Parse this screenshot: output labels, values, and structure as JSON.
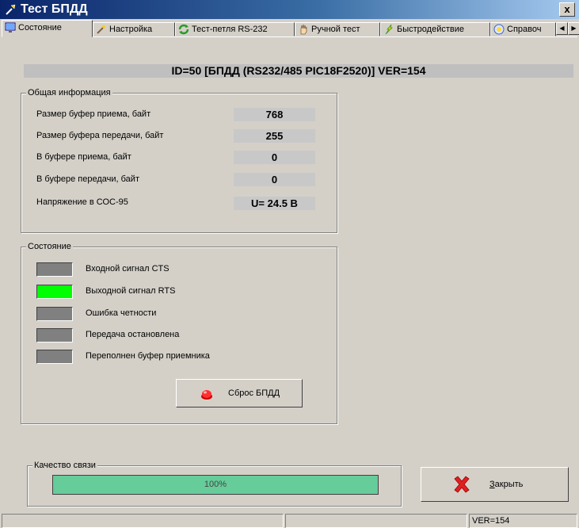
{
  "window": {
    "title": "Тест БПДД",
    "close_label": "x"
  },
  "tabs": [
    {
      "label": "Состояние",
      "icon": "monitor-icon"
    },
    {
      "label": "Настройка",
      "icon": "wand-icon"
    },
    {
      "label": "Тест-петля RS-232",
      "icon": "arrows-loop-icon"
    },
    {
      "label": "Ручной тест",
      "icon": "hand-icon"
    },
    {
      "label": "Быстродействие",
      "icon": "lightning-icon"
    },
    {
      "label": "Справоч",
      "icon": "info-icon"
    }
  ],
  "header": {
    "device_id": "ID=50 [БПДД (RS232/485 PIC18F2520)]  VER=154"
  },
  "general_info": {
    "title": "Общая информация",
    "rows": [
      {
        "label": "Размер буфер приема, байт",
        "value": "768"
      },
      {
        "label": "Размер буфера передачи, байт",
        "value": "255"
      },
      {
        "label": "В буфере приема, байт",
        "value": "0"
      },
      {
        "label": "В буфере передачи, байт",
        "value": "0"
      },
      {
        "label": "Напряжение в СОС-95",
        "value": "U= 24.5 В"
      }
    ]
  },
  "state": {
    "title": "Состояние",
    "signals": [
      {
        "label": "Входной сигнал CTS",
        "color": "#808080",
        "active": false
      },
      {
        "label": "Выходной сигнал RTS",
        "color": "#00ff00",
        "active": true
      },
      {
        "label": "Ошибка четности",
        "color": "#808080",
        "active": false
      },
      {
        "label": "Передача остановлена",
        "color": "#808080",
        "active": false
      },
      {
        "label": "Переполнен буфер приемника",
        "color": "#808080",
        "active": false
      }
    ],
    "reset_button": "Сброс БПДД"
  },
  "quality": {
    "title": "Качество связи",
    "percent_text": "100%",
    "percent": 100
  },
  "close_button": {
    "label": "Закрыть",
    "underline": "З",
    "rest": "акрыть"
  },
  "statusbar": {
    "panels": [
      "",
      "",
      "VER=154"
    ]
  }
}
